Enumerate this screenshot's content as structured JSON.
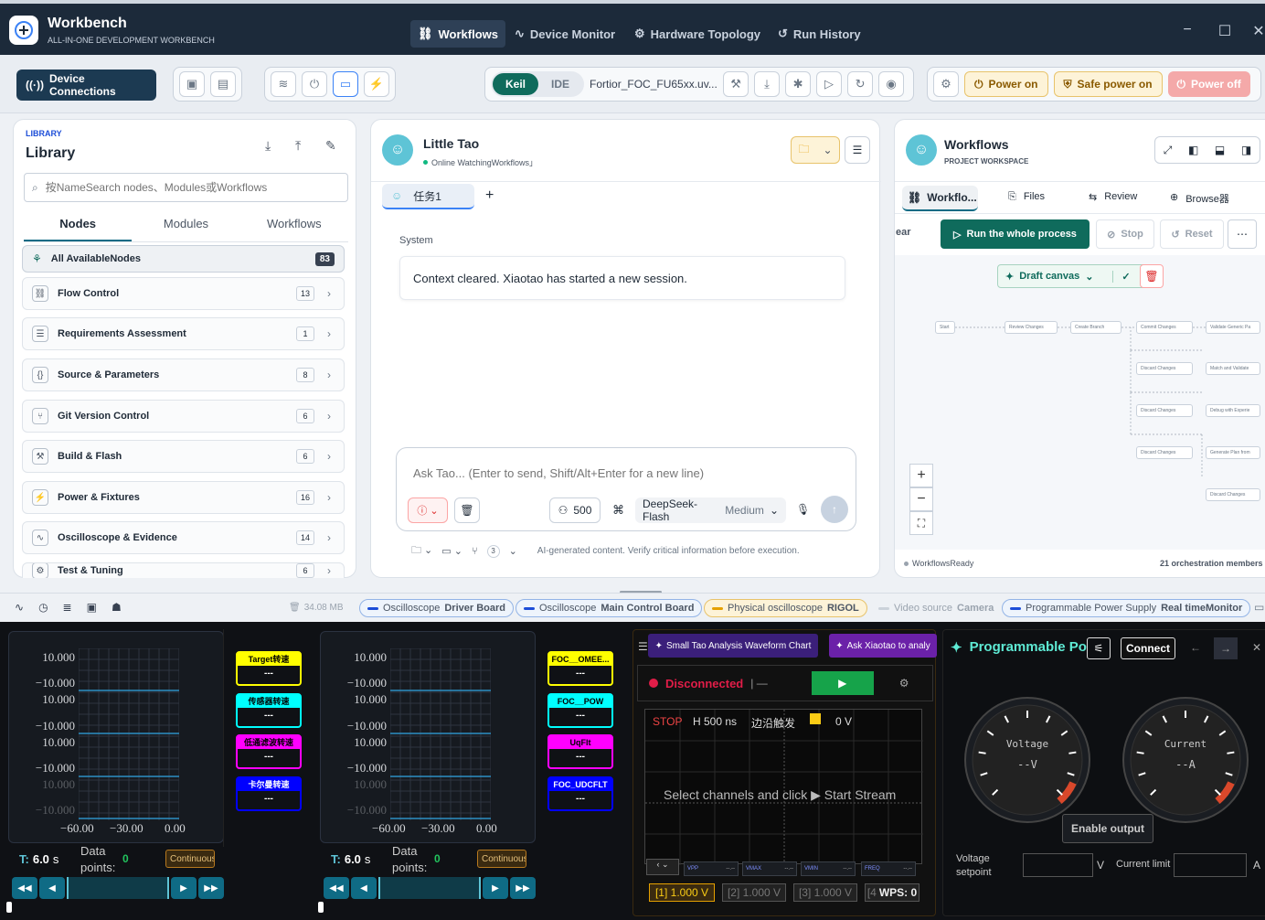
{
  "app": {
    "title": "Workbench",
    "subtitle": "ALL-IN-ONE DEVELOPMENT WORKBENCH"
  },
  "nav": {
    "tabs": [
      {
        "label": "Workflows"
      },
      {
        "label": "Device Monitor"
      },
      {
        "label": "Hardware Topology"
      },
      {
        "label": "Run History"
      }
    ]
  },
  "toolbar": {
    "device_connections": "Device Connections",
    "keil": "Keil",
    "ide": "IDE",
    "project": "Fortior_FOC_FU65xx.uv...",
    "power_on": "Power on",
    "safe_power_on": "Safe power on",
    "power_off": "Power off"
  },
  "library": {
    "kicker": "LIBRARY",
    "title": "Library",
    "search_placeholder": "按NameSearch nodes、Modules或Workflows",
    "tabs": [
      "Nodes",
      "Modules",
      "Workflows"
    ],
    "all": {
      "label": "All AvailableNodes",
      "count": "83"
    },
    "items": [
      {
        "label": "Flow Control",
        "count": "13"
      },
      {
        "label": "Requirements Assessment",
        "count": "1"
      },
      {
        "label": "Source & Parameters",
        "count": "8"
      },
      {
        "label": "Git Version Control",
        "count": "6"
      },
      {
        "label": "Build & Flash",
        "count": "6"
      },
      {
        "label": "Power & Fixtures",
        "count": "16"
      },
      {
        "label": "Oscilloscope & Evidence",
        "count": "14"
      },
      {
        "label": "Test & Tuning",
        "count": "6"
      }
    ]
  },
  "chat": {
    "name": "Little Tao",
    "status": "Online WatchingWorkflows」",
    "tab": "任务1",
    "system_label": "System",
    "system_msg": "Context cleared. Xiaotao has started a new session.",
    "input_placeholder": "Ask Tao... (Enter to send, Shift/Alt+Enter for a new line)",
    "tokens": "500",
    "model": "DeepSeek-Flash",
    "effort": "Medium",
    "branch_count": "3",
    "disclaimer": "AI-generated content. Verify critical information before execution."
  },
  "workflows": {
    "title": "Workflows",
    "subtitle": "PROJECT WORKSPACE",
    "tabs": [
      "Workflo...",
      "Files",
      "Review",
      "Browse器"
    ],
    "clear": "ear",
    "run": "Run the whole process",
    "stop": "Stop",
    "reset": "Reset",
    "draft": "Draft canvas",
    "status": "WorkflowsReady",
    "members": "21 orchestration members",
    "nodes": [
      "Start",
      "Review Changes",
      "Create Branch",
      "Commit Changes",
      "Validate Generic Pa",
      "Discard Changes",
      "Match and Validate",
      "Discard Changes",
      "Debug with Experie",
      "Discard Changes",
      "Generate Plan from",
      "Discard Changes"
    ]
  },
  "status": {
    "memory": "34.08 MB",
    "chips": [
      {
        "kind": "Oscilloscope",
        "name": "Driver Board"
      },
      {
        "kind": "Oscilloscope",
        "name": "Main Control Board"
      },
      {
        "kind": "Physical oscilloscope",
        "name": "RIGOL"
      },
      {
        "kind": "Video source",
        "name": "Camera"
      },
      {
        "kind": "Programmable Power Supply",
        "name": "Real timeMonitor"
      }
    ]
  },
  "scope1": {
    "yticks": [
      "10.000",
      "−10.000",
      "10.000",
      "−10.000",
      "10.000",
      "−10.000",
      "10.000",
      "−10.000"
    ],
    "xticks": [
      "−60.00",
      "−30.00",
      "0.00"
    ],
    "channels": [
      {
        "name": "Target转速",
        "value": "---",
        "color": "#ffff00"
      },
      {
        "name": "传感器转速",
        "value": "---",
        "color": "#00ffff"
      },
      {
        "name": "低通滤波转速",
        "value": "---",
        "color": "#ff00ff"
      },
      {
        "name": "卡尔曼转速",
        "value": "---",
        "color": "#0000ff"
      }
    ],
    "t_label": "T:",
    "t_value": "6.0",
    "t_unit": "s",
    "dp_label": "Data points:",
    "dp_value": "0",
    "mode": "Continuous"
  },
  "scope2": {
    "yticks": [
      "10.000",
      "−10.000",
      "10.000",
      "−10.000",
      "10.000",
      "−10.000",
      "10.000",
      "−10.000"
    ],
    "xticks": [
      "−60.00",
      "−30.00",
      "0.00"
    ],
    "channels": [
      {
        "name": "FOC__OMEE...",
        "value": "---",
        "color": "#ffff00"
      },
      {
        "name": "FOC__POW",
        "value": "---",
        "color": "#00ffff"
      },
      {
        "name": "UqFlt",
        "value": "---",
        "color": "#ff00ff"
      },
      {
        "name": "FOC_UDCFLT",
        "value": "---",
        "color": "#0000ff"
      }
    ],
    "t_label": "T:",
    "t_value": "6.0",
    "t_unit": "s",
    "dp_label": "Data points:",
    "dp_value": "0",
    "mode": "Continuous"
  },
  "rigol": {
    "btn1": "Small Tao Analysis Waveform Chart",
    "btn2": "Ask Xiaotao to analy",
    "status": "Disconnected",
    "stop": "STOP",
    "hscale": "H 500 ns",
    "trigger": "边沿触发",
    "tlevel": "0 V",
    "hint": "Select channels and click ▶ Start Stream",
    "meas": [
      "VPP",
      "VMAX",
      "VMIN",
      "FREQ"
    ],
    "meas_val": "--.--",
    "volts": [
      "[1] 1.000 V",
      "[2] 1.000 V",
      "[3] 1.000 V",
      "[4"
    ],
    "wps": "WPS: 0"
  },
  "psu": {
    "title": "Programmable Po",
    "connect": "Connect",
    "voltage_label": "Voltage",
    "voltage_value": "--V",
    "current_label": "Current",
    "current_value": "--A",
    "enable": "Enable output",
    "setpoint": "Voltage setpoint",
    "v_unit": "V",
    "limit": "Current limit",
    "a_unit": "A"
  }
}
